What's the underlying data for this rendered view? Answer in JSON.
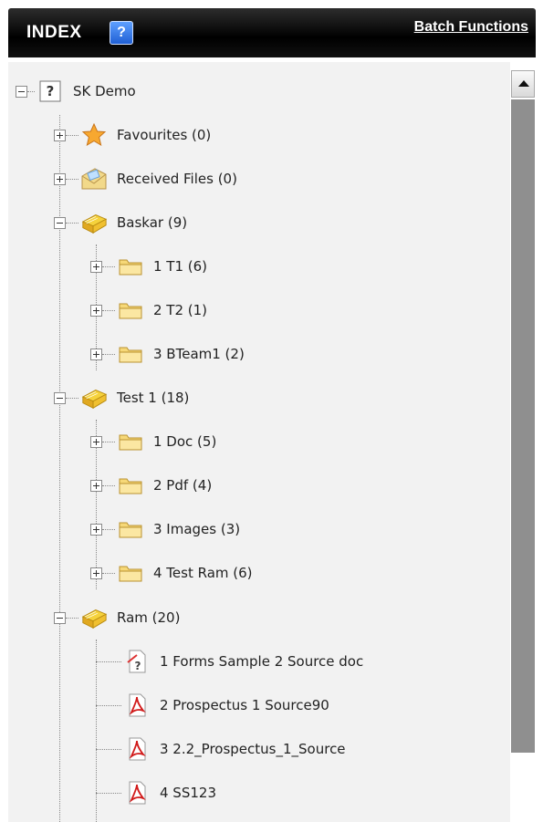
{
  "header": {
    "title": "INDEX",
    "help_label": "?",
    "batch_link": "Batch Functions"
  },
  "tree": {
    "root": "SK Demo",
    "favourites": "Favourites (0)",
    "received": "Received Files (0)",
    "baskar": {
      "label": "Baskar (9)",
      "children": [
        "1 T1 (6)",
        "2 T2 (1)",
        "3 BTeam1 (2)"
      ]
    },
    "test1": {
      "label": "Test 1 (18)",
      "children": [
        "1 Doc (5)",
        "2 Pdf (4)",
        "3 Images (3)",
        "4 Test Ram (6)"
      ]
    },
    "ram": {
      "label": "Ram (20)",
      "children": [
        "1 Forms Sample 2 Source doc",
        "2 Prospectus 1 Source90",
        "3 2.2_Prospectus_1_Source",
        "4 SS123"
      ]
    }
  },
  "colors": {
    "header_bg": "#000000",
    "panel_bg": "#f2f2f2",
    "folder": "#f6d878",
    "pdf": "#d11a1a"
  }
}
